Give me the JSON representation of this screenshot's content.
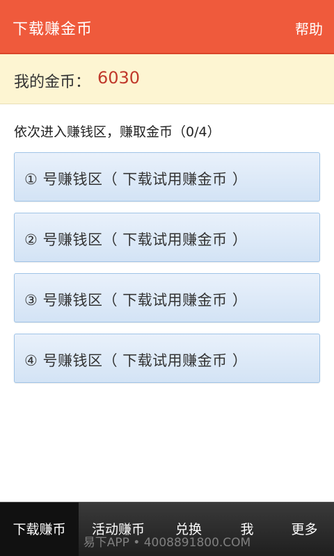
{
  "header": {
    "title": "下载赚金币",
    "help_label": "帮助"
  },
  "coins": {
    "label": "我的金币：",
    "value": "6030"
  },
  "instruction": "依次进入赚钱区，赚取金币（0/4）",
  "zones": [
    {
      "label": "① 号赚钱区（ 下载试用赚金币 ）"
    },
    {
      "label": "② 号赚钱区（ 下载试用赚金币 ）"
    },
    {
      "label": "③ 号赚钱区（ 下载试用赚金币 ）"
    },
    {
      "label": "④ 号赚钱区（ 下载试用赚金币 ）"
    }
  ],
  "tabs": [
    {
      "label": "下载赚币",
      "active": true
    },
    {
      "label": "活动赚币",
      "active": false
    },
    {
      "label": "兑换",
      "active": false
    },
    {
      "label": "我",
      "active": false
    },
    {
      "label": "更多",
      "active": false
    }
  ],
  "watermark": "易下APP • 4008891800.COM",
  "colors": {
    "header_bg": "#ef5a3c",
    "coins_bar_bg": "#fdf5d2",
    "coins_value": "#c0392b",
    "zone_border": "#9fc3e6",
    "tabbar_bg": "#2a2a2a"
  }
}
